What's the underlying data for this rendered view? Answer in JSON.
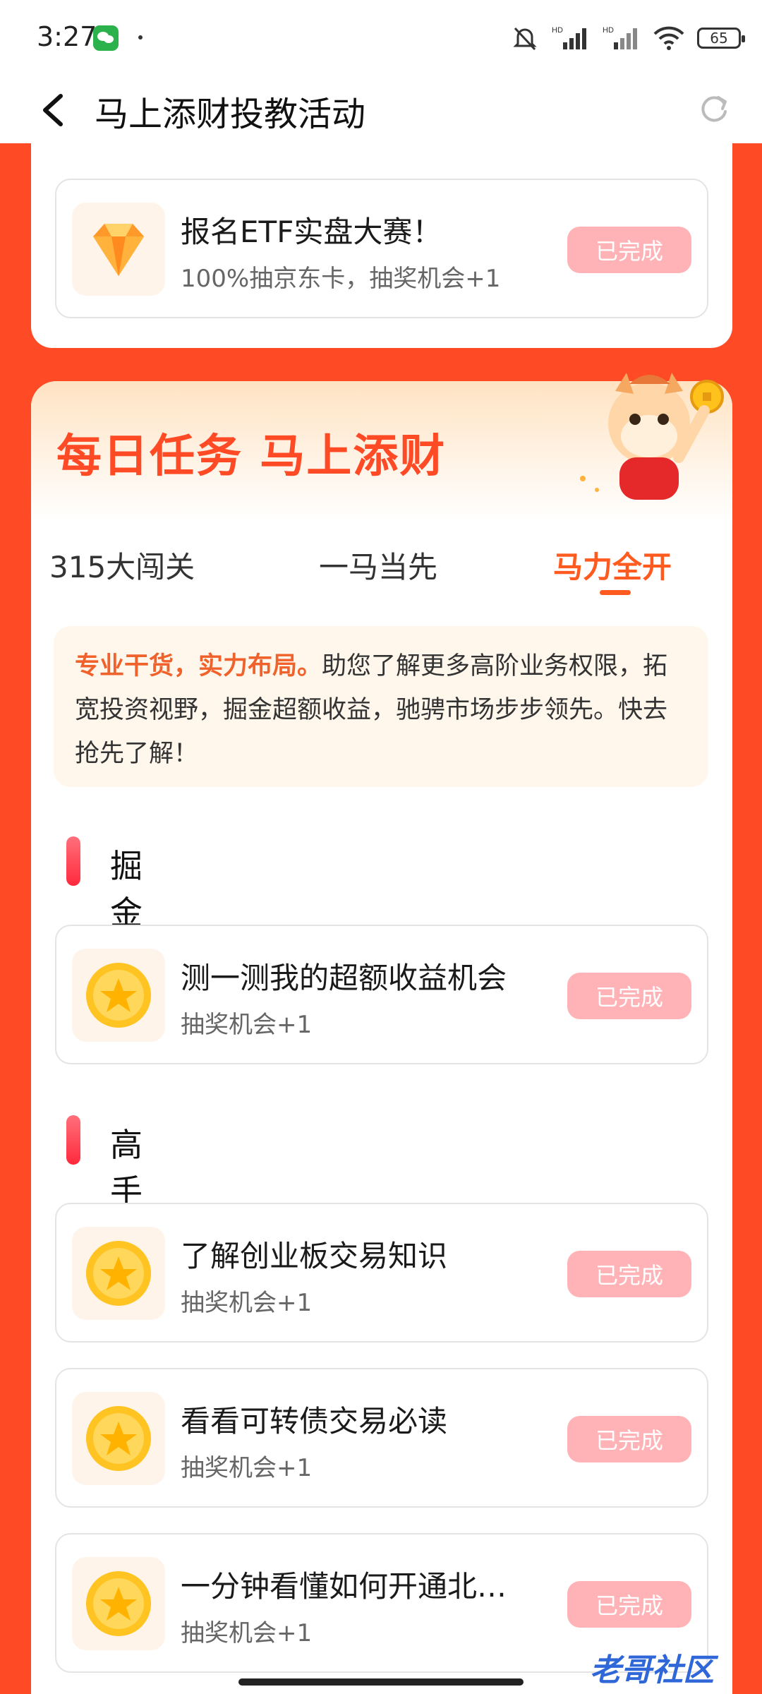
{
  "status_bar": {
    "time": "3:27",
    "battery": "65",
    "signal_labels": [
      "HD",
      "HD"
    ]
  },
  "nav": {
    "title": "马上添财投教活动"
  },
  "top_card": {
    "task": {
      "title": "报名ETF实盘大赛！",
      "subtitle": "100%抽京东卡，抽奖机会+1",
      "button": "已完成",
      "icon": "diamond-icon"
    }
  },
  "daily": {
    "banner_title": "每日任务 马上添财",
    "tabs": [
      {
        "label": "315大闯关",
        "active": false
      },
      {
        "label": "一马当先",
        "active": false
      },
      {
        "label": "马力全开",
        "active": true
      }
    ],
    "intro": {
      "highlight": "专业干货，实力布局。",
      "text": "助您了解更多高阶业务权限，拓宽投资视野，掘金超额收益，驰骋市场步步领先。快去抢先了解！"
    },
    "sections": [
      {
        "title": "掘金超额",
        "tasks": [
          {
            "title": "测一测我的超额收益机会",
            "subtitle": "抽奖机会+1",
            "button": "已完成",
            "icon": "gold-coin-icon"
          }
        ]
      },
      {
        "title": "高手进阶",
        "tasks": [
          {
            "title": "了解创业板交易知识",
            "subtitle": "抽奖机会+1",
            "button": "已完成",
            "icon": "gold-coin-icon"
          },
          {
            "title": "看看可转债交易必读",
            "subtitle": "抽奖机会+1",
            "button": "已完成",
            "icon": "gold-coin-icon"
          },
          {
            "title": "一分钟看懂如何开通北…",
            "subtitle": "抽奖机会+1",
            "button": "已完成",
            "icon": "gold-coin-icon"
          }
        ]
      }
    ]
  },
  "watermark": "老哥社区",
  "colors": {
    "background": "#ff4a26",
    "accent": "#ff5a20",
    "done_button": "#ffb3b7"
  }
}
